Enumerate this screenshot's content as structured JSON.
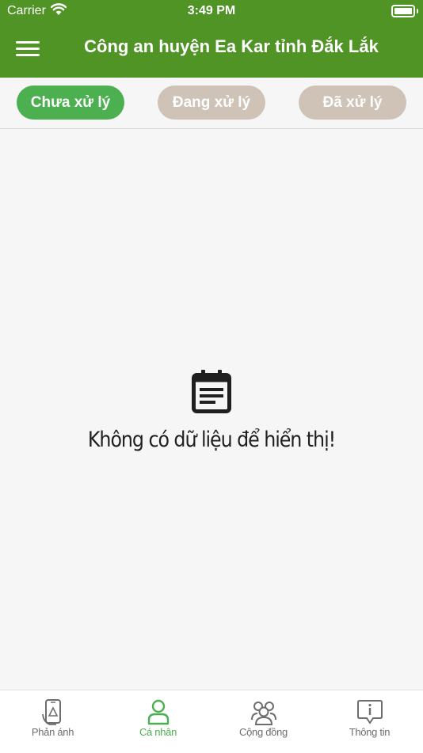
{
  "status_bar": {
    "carrier": "Carrier",
    "time": "3:49 PM"
  },
  "header": {
    "title": "Công an huyện Ea Kar tỉnh Đắk Lắk",
    "menu_icon": "hamburger-menu-icon"
  },
  "filter_tabs": [
    {
      "label": "Chưa xử lý",
      "active": true
    },
    {
      "label": "Đang xử lý",
      "active": false
    },
    {
      "label": "Đã xử lý",
      "active": false
    }
  ],
  "empty_state": {
    "message": "Không có dữ liệu để hiển thị!",
    "icon": "document-list-icon"
  },
  "bottom_nav": [
    {
      "label": "Phản ánh",
      "icon": "phone-report-icon",
      "active": false
    },
    {
      "label": "Cá nhân",
      "icon": "user-icon",
      "active": true
    },
    {
      "label": "Cộng đồng",
      "icon": "community-icon",
      "active": false
    },
    {
      "label": "Thông tin",
      "icon": "info-message-icon",
      "active": false
    }
  ],
  "colors": {
    "header_green": "#4f9424",
    "active_tab": "#4caf50",
    "inactive_tab": "#cfc3b8",
    "nav_active": "#4caf50",
    "nav_inactive": "#6d6d6d",
    "background": "#f6f6f6"
  }
}
